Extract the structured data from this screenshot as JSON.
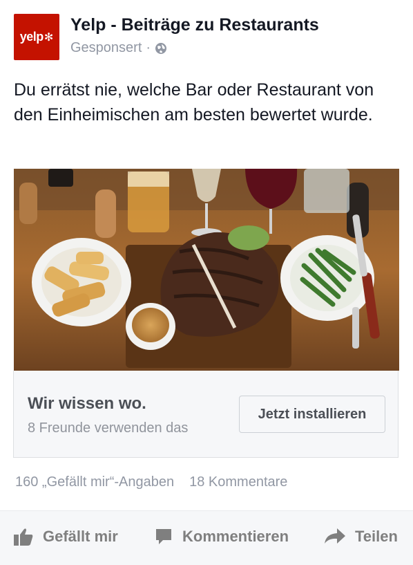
{
  "post": {
    "page_name": "Yelp - Beiträge zu Restaurants",
    "sponsored_label": "Gesponsert",
    "separator": "·",
    "logo_text": "yelp",
    "body_text": "Du errätst nie, welche Bar oder Restaurant von den Einheimischen am besten bewertet wurde."
  },
  "cta": {
    "title": "Wir wissen wo.",
    "subtitle": "8 Freunde verwenden das",
    "button_label": "Jetzt installieren"
  },
  "stats": {
    "likes": "160 „Gefällt mir“-Angaben",
    "comments": "18 Kommentare"
  },
  "actions": {
    "like": "Gefällt mir",
    "comment": "Kommentieren",
    "share": "Teilen"
  },
  "colors": {
    "brand": "#c41200",
    "muted_text": "#9197a3"
  },
  "icons": {
    "logo": "yelp-logo",
    "privacy": "globe-icon",
    "like": "thumbs-up-icon",
    "comment": "speech-bubble-icon",
    "share": "share-arrow-icon"
  }
}
